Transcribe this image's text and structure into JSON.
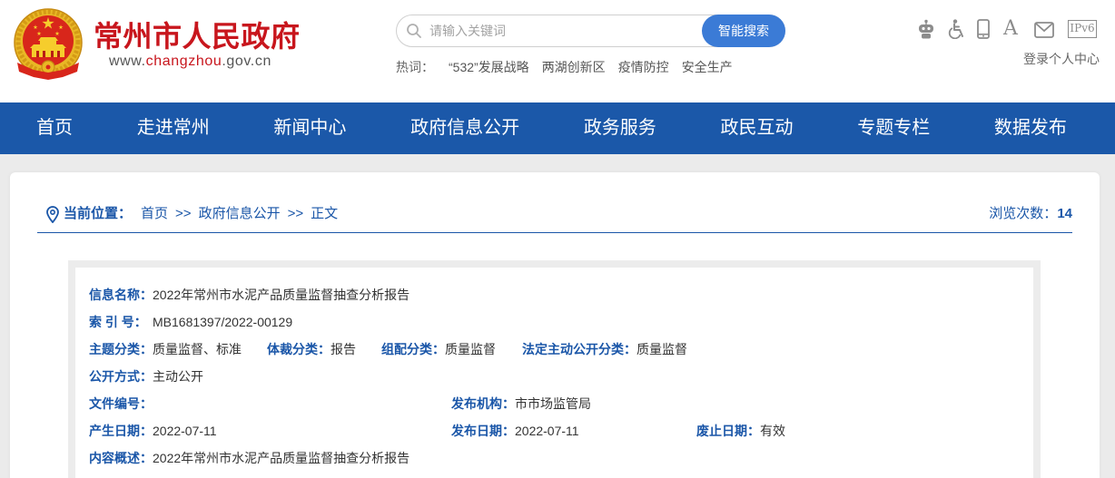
{
  "site": {
    "title": "常州市人民政府",
    "url_prefix": "www.",
    "url_domain": "changzhou",
    "url_suffix": ".gov.cn"
  },
  "search": {
    "placeholder": "请输入关键词",
    "button_label": "智能搜索",
    "icon": "search-icon"
  },
  "hot_words": {
    "label": "热词：",
    "items": [
      "“532”发展战略",
      "两湖创新区",
      "疫情防控",
      "安全生产"
    ]
  },
  "tools": {
    "icons": [
      "robot-icon",
      "accessibility-icon",
      "mobile-icon",
      "font-size-icon",
      "mail-icon",
      "ipv6-icon"
    ],
    "font_label": "A",
    "ipv6_label": "IPv6",
    "login_label": "登录个人中心"
  },
  "nav": {
    "items": [
      "首页",
      "走进常州",
      "新闻中心",
      "政府信息公开",
      "政务服务",
      "政民互动",
      "专题专栏",
      "数据发布"
    ]
  },
  "breadcrumb": {
    "label": "当前位置：",
    "items": [
      "首页",
      "政府信息公开",
      "正文"
    ],
    "separator": ">>"
  },
  "views": {
    "label": "浏览次数：",
    "count": "14"
  },
  "info": {
    "name": {
      "label": "信息名称：",
      "value": "2022年常州市水泥产品质量监督抽查分析报告"
    },
    "index_no": {
      "label": "索 引 号：",
      "value": "MB1681397/2022-00129"
    },
    "subject": {
      "label": "主题分类：",
      "value": "质量监督、标准"
    },
    "genre": {
      "label": "体裁分类：",
      "value": "报告"
    },
    "assembly": {
      "label": "组配分类：",
      "value": "质量监督"
    },
    "statutory": {
      "label": "法定主动公开分类：",
      "value": "质量监督"
    },
    "disclosure": {
      "label": "公开方式：",
      "value": "主动公开"
    },
    "file_no": {
      "label": "文件编号："
    },
    "publisher": {
      "label": "发布机构：",
      "value": "市市场监管局"
    },
    "created": {
      "label": "产生日期：",
      "value": "2022-07-11"
    },
    "published": {
      "label": "发布日期：",
      "value": "2022-07-11"
    },
    "expiry": {
      "label": "废止日期：",
      "value": "有效"
    },
    "summary": {
      "label": "内容概述：",
      "value": "2022年常州市水泥产品质量监督抽查分析报告"
    }
  },
  "colors": {
    "brand_red": "#c8161d",
    "nav_blue": "#1b58a9",
    "link_blue": "#1a56a8",
    "search_button": "#3b7bd6",
    "icon_gray": "#8c8c8c",
    "page_gray": "#ebebeb"
  }
}
